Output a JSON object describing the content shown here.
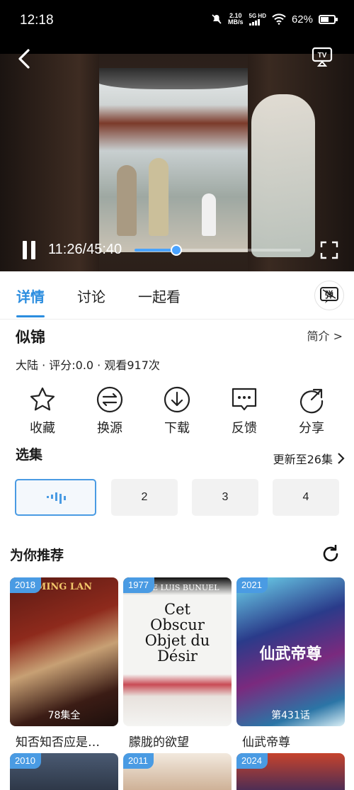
{
  "status_bar": {
    "time": "12:18",
    "net_speed": "2.10",
    "net_unit": "MB/s",
    "signal_label": "5G HD",
    "battery": "62%",
    "battery_level": 0.62
  },
  "player": {
    "current_time": "11:26",
    "duration": "45:40",
    "time_display": "11:26/45:40",
    "progress": 0.25
  },
  "tabs": [
    {
      "label": "详情"
    },
    {
      "label": "讨论"
    },
    {
      "label": "一起看"
    }
  ],
  "details": {
    "title": "似锦",
    "intro_link": "简介 >",
    "meta": "大陆 · 评分:0.0 · 观看917次"
  },
  "actions": [
    {
      "label": "收藏",
      "icon": "star-icon"
    },
    {
      "label": "换源",
      "icon": "switch-icon"
    },
    {
      "label": "下载",
      "icon": "download-icon"
    },
    {
      "label": "反馈",
      "icon": "feedback-icon"
    },
    {
      "label": "分享",
      "icon": "share-icon"
    }
  ],
  "episodes": {
    "title": "选集",
    "update": "更新至26集",
    "items": [
      {
        "label": "",
        "playing": true
      },
      {
        "label": "2"
      },
      {
        "label": "3"
      },
      {
        "label": "4"
      }
    ]
  },
  "recommend": {
    "title": "为你推荐",
    "items": [
      {
        "year": "2018",
        "badge": "78集全",
        "name": "知否知否应是…",
        "poster_text": "MING LAN"
      },
      {
        "year": "1977",
        "badge": "",
        "name": "朦胧的欲望",
        "poster_text": "Cet Obscur Objet du Désir",
        "poster_header": "M DE LUIS BUNUEL"
      },
      {
        "year": "2021",
        "badge": "第431话",
        "name": "仙武帝尊",
        "poster_text": "仙武帝尊"
      }
    ],
    "next_row": [
      {
        "year": "2010"
      },
      {
        "year": "2011"
      },
      {
        "year": "2024"
      }
    ]
  },
  "colors": {
    "accent": "#2b8ddf",
    "badge": "#4a9be3"
  }
}
